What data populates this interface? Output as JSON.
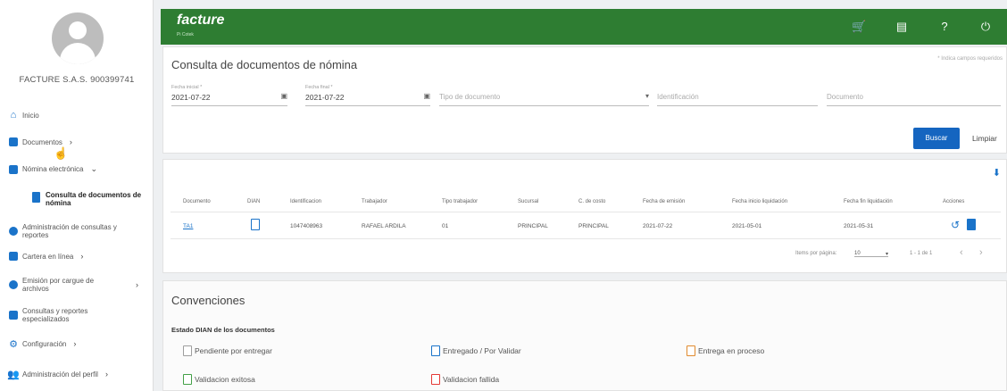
{
  "sidebar": {
    "company": "FACTURE S.A.S. 900399741",
    "items": [
      {
        "label": "Inicio",
        "icon": "home-icon"
      },
      {
        "label": "Documentos",
        "icon": "document-icon"
      },
      {
        "label": "Nómina electrónica",
        "icon": "folder-icon"
      },
      {
        "label": "Administración de consultas y reportes",
        "icon": "search-doc-icon"
      },
      {
        "label": "Cartera en línea",
        "icon": "wallet-icon"
      },
      {
        "label": "Emisión por cargue de archivos",
        "icon": "cloud-upload-icon"
      },
      {
        "label": "Consultas y reportes especializados",
        "icon": "report-icon"
      },
      {
        "label": "Configuración",
        "icon": "gear-icon"
      },
      {
        "label": "Administración del perfil",
        "icon": "users-icon"
      }
    ],
    "subitem": "Consulta de documentos de nómina"
  },
  "header": {
    "logo": "facture",
    "logo_sub": "Pi Cotek",
    "icons": [
      "cart-icon",
      "receipt-icon",
      "help-icon",
      "power-icon"
    ]
  },
  "search": {
    "title": "Consulta de documentos de nómina",
    "required_note": "* Indica campos requeridos",
    "fecha_inicial_label": "Fecha inicial *",
    "fecha_inicial": "2021-07-22",
    "fecha_final_label": "Fecha final *",
    "fecha_final": "2021-07-22",
    "tipo_placeholder": "Tipo de documento",
    "identificacion_placeholder": "Identificación",
    "documento_placeholder": "Documento",
    "buscar": "Buscar",
    "limpiar": "Limpiar"
  },
  "table": {
    "headers": [
      "Documento",
      "DIAN",
      "Identificacion",
      "Trabajador",
      "Tipo trabajador",
      "Sucursal",
      "C. de costo",
      "Fecha de emisión",
      "Fecha inicio liquidación",
      "Fecha fin liquidación",
      "Acciones"
    ],
    "row": {
      "documento": "TA1",
      "identificacion": "1047408963",
      "trabajador": "RAFAEL ARDILA",
      "tipo": "01",
      "sucursal": "PRINCIPAL",
      "costo": "PRINCIPAL",
      "emision": "2021-07-22",
      "inicio": "2021-05-01",
      "fin": "2021-05-31"
    },
    "items_per_page_label": "Items por página:",
    "items_per_page": "10",
    "range": "1 - 1 de 1"
  },
  "conventions": {
    "title": "Convenciones",
    "subtitle": "Estado DIAN de los documentos",
    "items": [
      {
        "label": "Pendiente por entregar",
        "color": "#9e9e9e"
      },
      {
        "label": "Entregado / Por Validar",
        "color": "#1a73c9"
      },
      {
        "label": "Entrega en proceso",
        "color": "#e08a2e"
      },
      {
        "label": "Validacion exitosa",
        "color": "#43a047"
      },
      {
        "label": "Validacion fallida",
        "color": "#e53935"
      }
    ]
  }
}
